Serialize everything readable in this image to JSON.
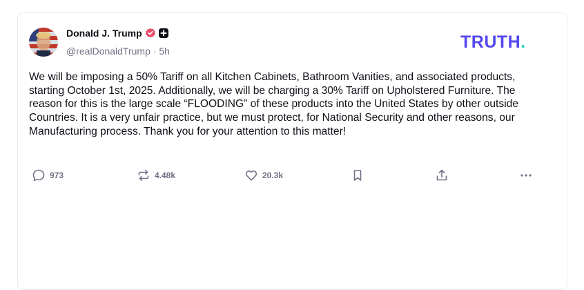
{
  "author": {
    "name": "Donald J. Trump",
    "handle": "@realDonaldTrump",
    "separator": "·",
    "time": "5h",
    "verified_color": "#e84d6b"
  },
  "brand": {
    "logo_text": "TRUTH",
    "logo_dot": ".",
    "primary_color": "#5448ee",
    "accent_color": "#23d3b8"
  },
  "post": {
    "text": "We will be imposing a 50% Tariff on all Kitchen Cabinets, Bathroom Vanities, and associated products, starting October 1st, 2025. Additionally, we will be charging a 30% Tariff on Upholstered Furniture. The reason for this is the large scale “FLOODING” of these products into the United States by other outside Countries. It is a very unfair practice, but we must protect, for National Security and other reasons, our Manufacturing process. Thank you for your attention to this matter!"
  },
  "actions": {
    "replies": {
      "icon": "reply-icon",
      "count": "973"
    },
    "retruths": {
      "icon": "retruth-icon",
      "count": "4.48k"
    },
    "likes": {
      "icon": "heart-icon",
      "count": "20.3k"
    },
    "bookmark": {
      "icon": "bookmark-icon"
    },
    "share": {
      "icon": "share-icon"
    },
    "more": {
      "icon": "more-icon"
    }
  }
}
